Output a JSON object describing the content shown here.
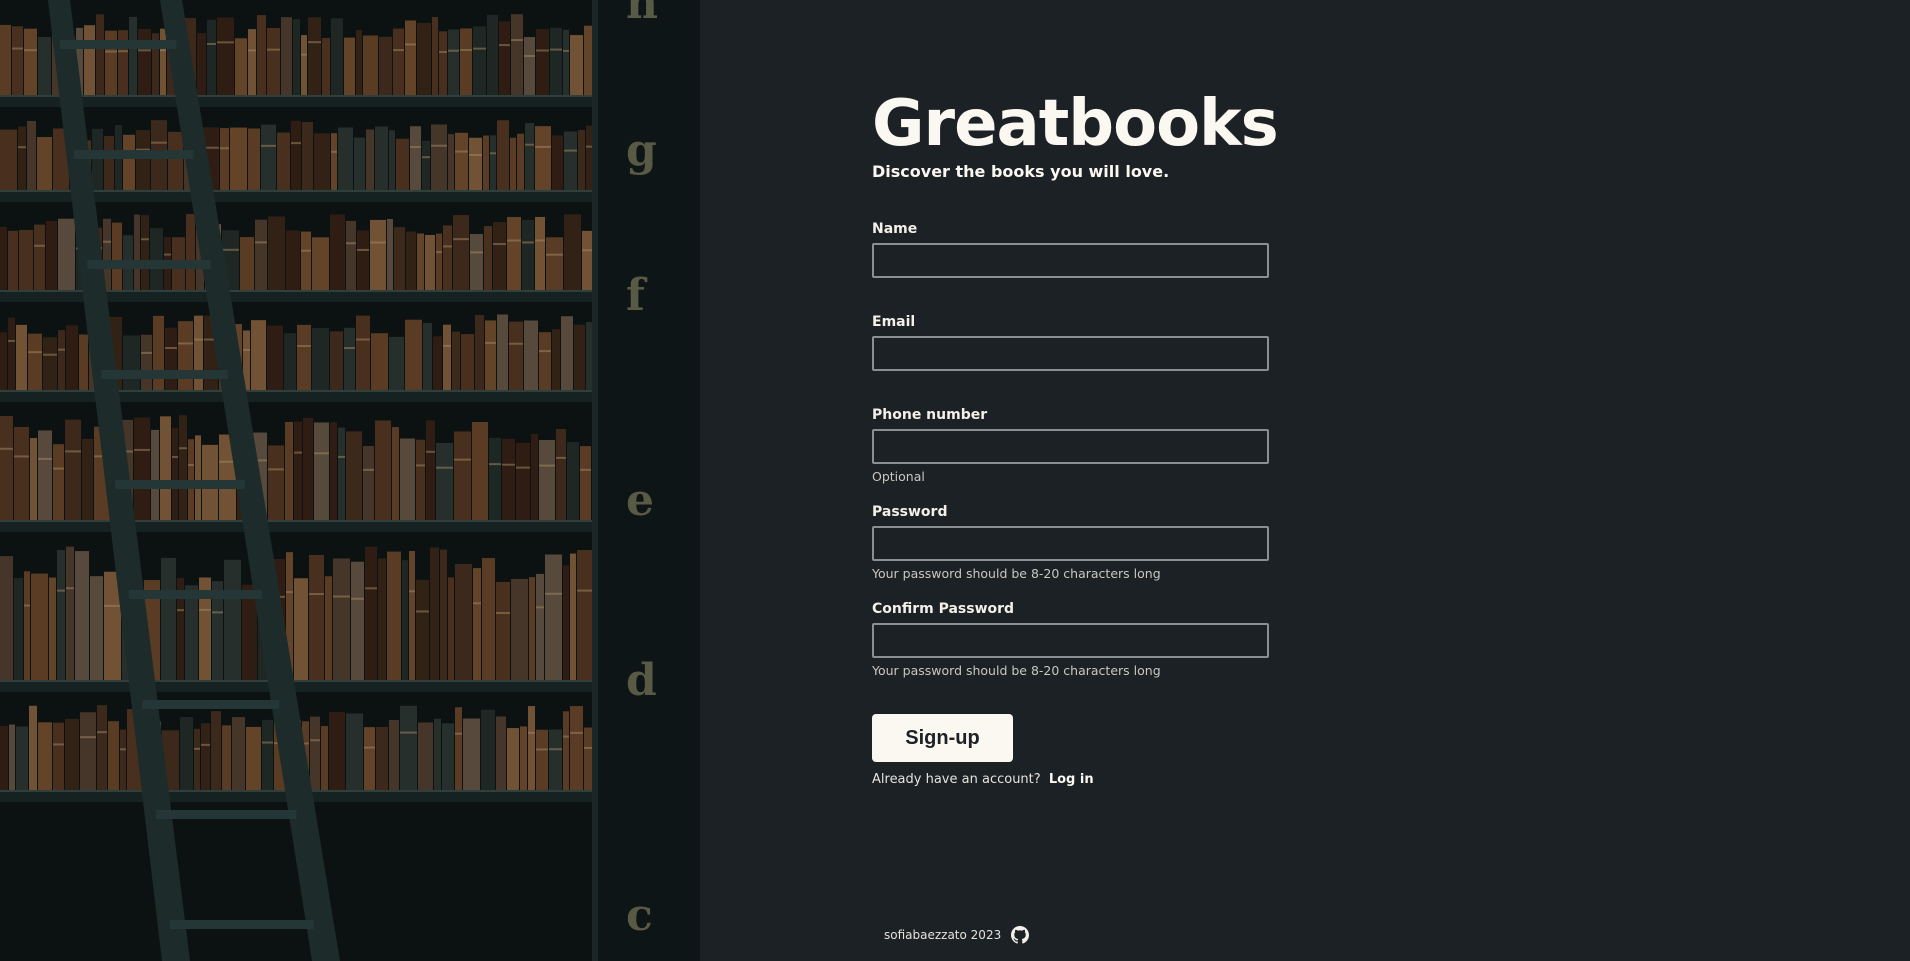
{
  "brand": {
    "title": "Greatbooks",
    "tagline": "Discover the books you will love."
  },
  "form": {
    "name_label": "Name",
    "name_value": "",
    "email_label": "Email",
    "email_value": "",
    "phone_label": "Phone number",
    "phone_value": "",
    "phone_hint": "Optional",
    "password_label": "Password",
    "password_value": "",
    "password_hint": "Your password should be 8-20 characters long",
    "confirm_label": "Confirm Password",
    "confirm_value": "",
    "confirm_hint": "Your password should be 8-20 characters long",
    "submit_label": "Sign-up",
    "login_prompt": "Already have an account?",
    "login_link": "Log in"
  },
  "footer": {
    "credit": "sofiabaezzato 2023",
    "icon": "github-icon"
  },
  "hero": {
    "image": "library-bookshelf-with-ladder",
    "shelf_letters": [
      "h",
      "g",
      "f",
      "e",
      "d",
      "c"
    ]
  },
  "colors": {
    "background": "#1b2124",
    "text": "#fbf7f1",
    "input_border": "#8a8f93",
    "button_bg": "#fbf7f1"
  }
}
